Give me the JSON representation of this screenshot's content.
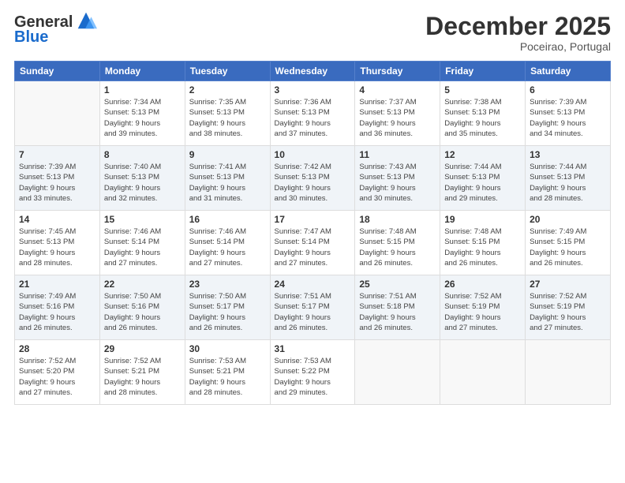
{
  "logo": {
    "general": "General",
    "blue": "Blue"
  },
  "header": {
    "month": "December 2025",
    "location": "Poceirao, Portugal"
  },
  "weekdays": [
    "Sunday",
    "Monday",
    "Tuesday",
    "Wednesday",
    "Thursday",
    "Friday",
    "Saturday"
  ],
  "weeks": [
    [
      {
        "day": "",
        "empty": true
      },
      {
        "day": "1",
        "sunrise": "7:34 AM",
        "sunset": "5:13 PM",
        "daylight": "9 hours and 39 minutes."
      },
      {
        "day": "2",
        "sunrise": "7:35 AM",
        "sunset": "5:13 PM",
        "daylight": "9 hours and 38 minutes."
      },
      {
        "day": "3",
        "sunrise": "7:36 AM",
        "sunset": "5:13 PM",
        "daylight": "9 hours and 37 minutes."
      },
      {
        "day": "4",
        "sunrise": "7:37 AM",
        "sunset": "5:13 PM",
        "daylight": "9 hours and 36 minutes."
      },
      {
        "day": "5",
        "sunrise": "7:38 AM",
        "sunset": "5:13 PM",
        "daylight": "9 hours and 35 minutes."
      },
      {
        "day": "6",
        "sunrise": "7:39 AM",
        "sunset": "5:13 PM",
        "daylight": "9 hours and 34 minutes."
      }
    ],
    [
      {
        "day": "7",
        "sunrise": "7:39 AM",
        "sunset": "5:13 PM",
        "daylight": "9 hours and 33 minutes."
      },
      {
        "day": "8",
        "sunrise": "7:40 AM",
        "sunset": "5:13 PM",
        "daylight": "9 hours and 32 minutes."
      },
      {
        "day": "9",
        "sunrise": "7:41 AM",
        "sunset": "5:13 PM",
        "daylight": "9 hours and 31 minutes."
      },
      {
        "day": "10",
        "sunrise": "7:42 AM",
        "sunset": "5:13 PM",
        "daylight": "9 hours and 30 minutes."
      },
      {
        "day": "11",
        "sunrise": "7:43 AM",
        "sunset": "5:13 PM",
        "daylight": "9 hours and 30 minutes."
      },
      {
        "day": "12",
        "sunrise": "7:44 AM",
        "sunset": "5:13 PM",
        "daylight": "9 hours and 29 minutes."
      },
      {
        "day": "13",
        "sunrise": "7:44 AM",
        "sunset": "5:13 PM",
        "daylight": "9 hours and 28 minutes."
      }
    ],
    [
      {
        "day": "14",
        "sunrise": "7:45 AM",
        "sunset": "5:13 PM",
        "daylight": "9 hours and 28 minutes."
      },
      {
        "day": "15",
        "sunrise": "7:46 AM",
        "sunset": "5:14 PM",
        "daylight": "9 hours and 27 minutes."
      },
      {
        "day": "16",
        "sunrise": "7:46 AM",
        "sunset": "5:14 PM",
        "daylight": "9 hours and 27 minutes."
      },
      {
        "day": "17",
        "sunrise": "7:47 AM",
        "sunset": "5:14 PM",
        "daylight": "9 hours and 27 minutes."
      },
      {
        "day": "18",
        "sunrise": "7:48 AM",
        "sunset": "5:15 PM",
        "daylight": "9 hours and 26 minutes."
      },
      {
        "day": "19",
        "sunrise": "7:48 AM",
        "sunset": "5:15 PM",
        "daylight": "9 hours and 26 minutes."
      },
      {
        "day": "20",
        "sunrise": "7:49 AM",
        "sunset": "5:15 PM",
        "daylight": "9 hours and 26 minutes."
      }
    ],
    [
      {
        "day": "21",
        "sunrise": "7:49 AM",
        "sunset": "5:16 PM",
        "daylight": "9 hours and 26 minutes."
      },
      {
        "day": "22",
        "sunrise": "7:50 AM",
        "sunset": "5:16 PM",
        "daylight": "9 hours and 26 minutes."
      },
      {
        "day": "23",
        "sunrise": "7:50 AM",
        "sunset": "5:17 PM",
        "daylight": "9 hours and 26 minutes."
      },
      {
        "day": "24",
        "sunrise": "7:51 AM",
        "sunset": "5:17 PM",
        "daylight": "9 hours and 26 minutes."
      },
      {
        "day": "25",
        "sunrise": "7:51 AM",
        "sunset": "5:18 PM",
        "daylight": "9 hours and 26 minutes."
      },
      {
        "day": "26",
        "sunrise": "7:52 AM",
        "sunset": "5:19 PM",
        "daylight": "9 hours and 27 minutes."
      },
      {
        "day": "27",
        "sunrise": "7:52 AM",
        "sunset": "5:19 PM",
        "daylight": "9 hours and 27 minutes."
      }
    ],
    [
      {
        "day": "28",
        "sunrise": "7:52 AM",
        "sunset": "5:20 PM",
        "daylight": "9 hours and 27 minutes."
      },
      {
        "day": "29",
        "sunrise": "7:52 AM",
        "sunset": "5:21 PM",
        "daylight": "9 hours and 28 minutes."
      },
      {
        "day": "30",
        "sunrise": "7:53 AM",
        "sunset": "5:21 PM",
        "daylight": "9 hours and 28 minutes."
      },
      {
        "day": "31",
        "sunrise": "7:53 AM",
        "sunset": "5:22 PM",
        "daylight": "9 hours and 29 minutes."
      },
      {
        "day": "",
        "empty": true
      },
      {
        "day": "",
        "empty": true
      },
      {
        "day": "",
        "empty": true
      }
    ]
  ],
  "labels": {
    "sunrise_prefix": "Sunrise: ",
    "sunset_prefix": "Sunset: ",
    "daylight_prefix": "Daylight: "
  }
}
